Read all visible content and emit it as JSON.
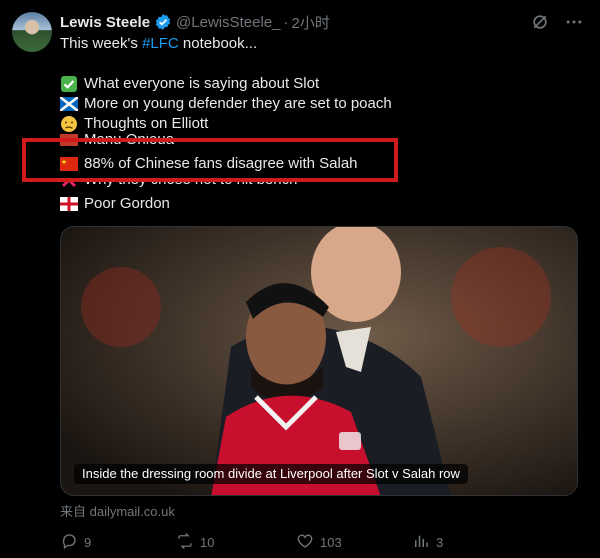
{
  "author": {
    "name": "Lewis Steele",
    "handle": "@LewisSteele_",
    "separator": "·",
    "time": "2小时"
  },
  "tweet": {
    "intro_before": "This week's ",
    "hashtag": "#LFC",
    "intro_after": " notebook...",
    "items": [
      {
        "icon": "check-mark-button-icon",
        "text": "What everyone is saying about Slot"
      },
      {
        "icon": "scotland-flag-icon",
        "text": "More on young defender they are set to poach"
      },
      {
        "icon": "confused-face-icon",
        "text": "Thoughts on Elliott"
      },
      {
        "icon": "partially-hidden-icon",
        "text": "Manu Onieua"
      },
      {
        "icon": "china-flag-icon",
        "text": "88% of Chinese fans disagree with Salah"
      },
      {
        "icon": "cross-mark-icon",
        "text": "Why they chose not to hit bench"
      },
      {
        "icon": "england-flag-icon",
        "text": "Poor Gordon"
      }
    ]
  },
  "media": {
    "caption": "Inside the dressing room divide at Liverpool after Slot v Salah row"
  },
  "source": {
    "label": "来自 dailymail.co.uk"
  },
  "actions": {
    "replies": "9",
    "reposts": "10",
    "likes": "103",
    "views": "3"
  },
  "colors": {
    "background": "#000000",
    "link": "#1d9bf0",
    "highlight_box": "#d11a1a",
    "muted": "#71767b"
  }
}
